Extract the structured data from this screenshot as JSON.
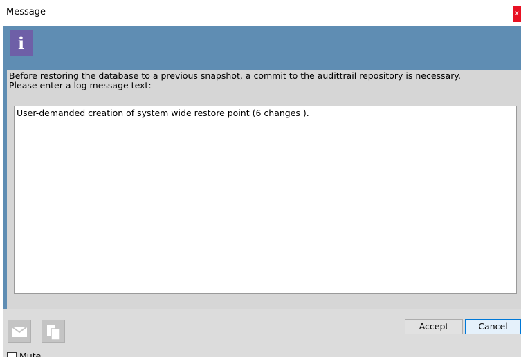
{
  "window": {
    "title": "Message",
    "close_glyph": "x"
  },
  "icons": {
    "info": "info-icon",
    "mail": "envelope-icon",
    "copy": "copy-icon"
  },
  "info_glyph": "i",
  "message": {
    "instruction_line1": "Before restoring the database to a previous snapshot, a commit to the audittrail repository is necessary.",
    "instruction_line2": "Please enter a log message text:",
    "log_text": "User-demanded creation of system wide restore point (6 changes )."
  },
  "buttons": {
    "accept_label": "Accept",
    "cancel_label": "Cancel"
  },
  "mute": {
    "label": "Mute",
    "checked": false
  },
  "colors": {
    "header_blue": "#5f8db3",
    "icon_purple": "#6e5fa7",
    "close_red": "#e81123",
    "focus_blue": "#0078d7"
  }
}
